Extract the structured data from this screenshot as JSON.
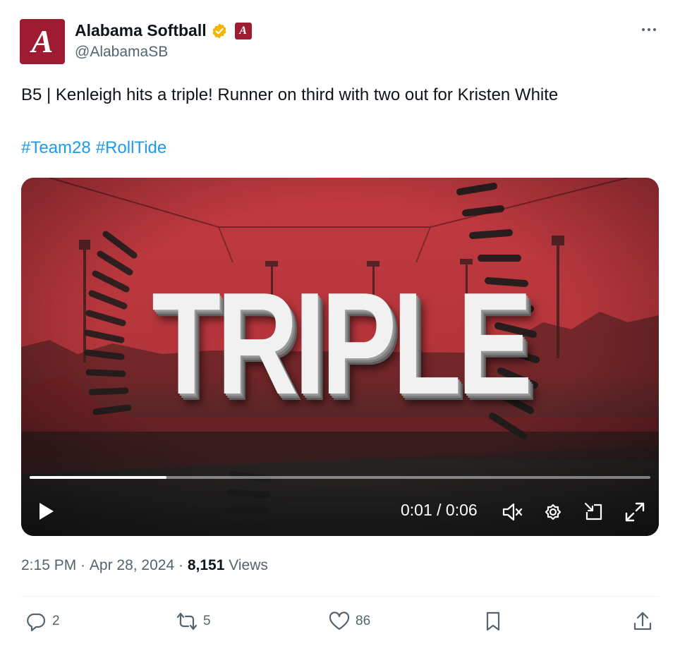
{
  "account": {
    "display_name": "Alabama Softball",
    "handle": "@AlabamaSB",
    "avatar_letter": "A",
    "verified_color": "#f4b400",
    "brand_color": "#9e1b32"
  },
  "tweet": {
    "text": "B5 | Kenleigh hits a triple! Runner on third with two out for Kristen White",
    "hashtags": [
      "#Team28",
      "#RollTide"
    ]
  },
  "video": {
    "overlay_text": "TRIPLE",
    "current_time": "0:01",
    "duration": "0:06",
    "time_display": "0:01 / 0:06",
    "progress_fraction": 0.22,
    "controls": [
      "play-icon",
      "mute-icon",
      "settings-icon",
      "pip-icon",
      "fullscreen-icon"
    ]
  },
  "meta": {
    "time": "2:15 PM",
    "separator": " · ",
    "date": "Apr 28, 2024",
    "views_count": "8,151",
    "views_label": " Views"
  },
  "actions": {
    "replies": "2",
    "reposts": "5",
    "likes": "86"
  },
  "colors": {
    "link": "#1d9bf0",
    "secondary_text": "#536471",
    "primary_text": "#0f1419"
  }
}
